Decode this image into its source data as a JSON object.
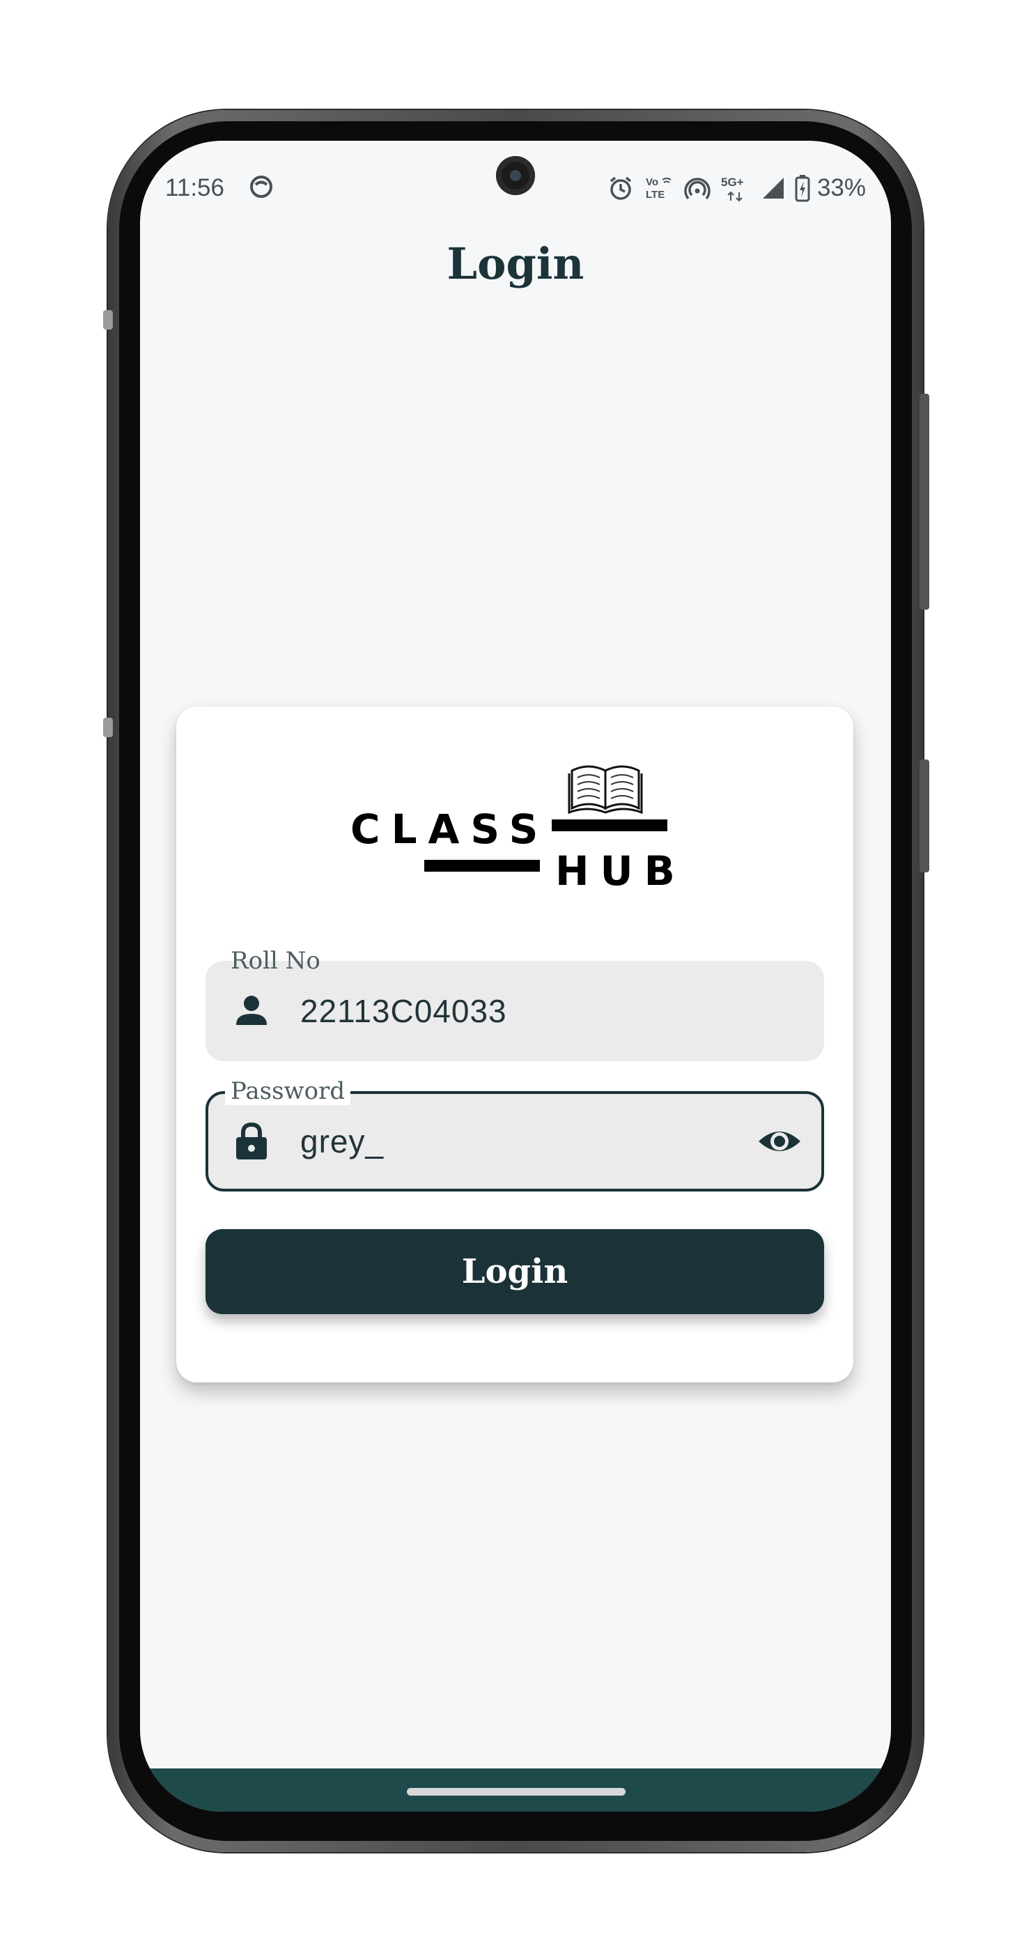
{
  "status_bar": {
    "time": "11:56",
    "battery_percent": "33%",
    "network": "5G+"
  },
  "page": {
    "title": "Login"
  },
  "logo": {
    "word1": "CLASS",
    "word2": "HUB"
  },
  "form": {
    "roll_label": "Roll No",
    "roll_value": "22113C04033",
    "password_label": "Password",
    "password_value": "grey_",
    "submit_label": "Login"
  },
  "colors": {
    "primary": "#1b3238",
    "background": "#f5f7f8",
    "input_fill": "#ebebeb",
    "nav_bar": "#1e4a4c"
  },
  "icons": {
    "roll": "person-icon",
    "password": "lock-icon",
    "visibility": "eye-icon"
  }
}
